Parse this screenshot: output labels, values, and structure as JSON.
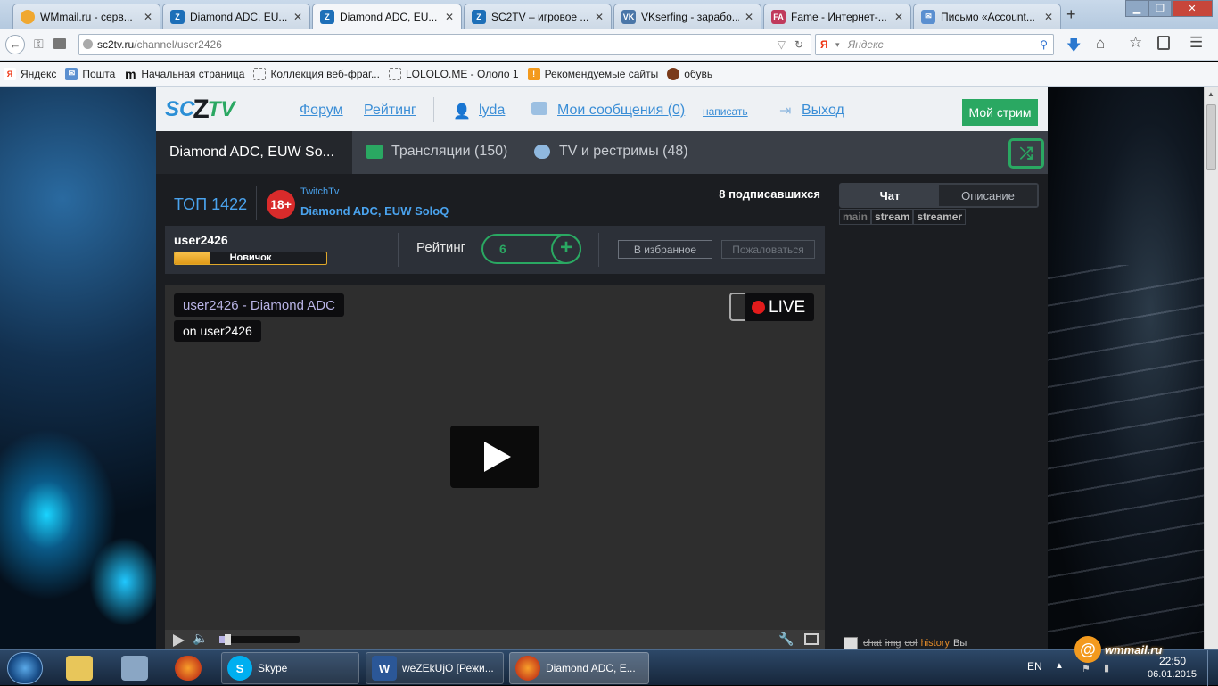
{
  "browser": {
    "tabs": [
      {
        "label": "WMmail.ru - серв...",
        "icon": "wmmail-favicon",
        "color": "#f0a830"
      },
      {
        "label": "Diamond ADC, EU...",
        "icon": "sc2tv-favicon",
        "color": "#1d6fb8"
      },
      {
        "label": "Diamond ADC, EU...",
        "icon": "sc2tv-favicon",
        "color": "#1d6fb8"
      },
      {
        "label": "SC2TV – игровое ...",
        "icon": "sc2tv-favicon",
        "color": "#1d6fb8"
      },
      {
        "label": "VKserfing - зарабо...",
        "icon": "vk-favicon",
        "color": "#4a76a8"
      },
      {
        "label": "Fame - Интернет-...",
        "icon": "fame-favicon",
        "color": "#c03a5c"
      },
      {
        "label": "Письмо «Account...",
        "icon": "mail-favicon",
        "color": "#5a8fd0"
      }
    ],
    "new_tab": "+",
    "url_host": "sc2tv.ru",
    "url_path": "/channel/user2426",
    "search_engine_badge": "Я",
    "search_placeholder": "Яндекс",
    "bookmarks": [
      {
        "label": "Яндекс",
        "icon": "yandex-icon"
      },
      {
        "label": "Пошта",
        "icon": "mail-icon"
      },
      {
        "label": "Начальная страница",
        "icon": "m-icon"
      },
      {
        "label": "Коллекция веб-фраг...",
        "icon": "webslice-icon"
      },
      {
        "label": "LOLOLO.ME - Ололо 1",
        "icon": "webslice-icon"
      },
      {
        "label": "Рекомендуемые сайты",
        "icon": "bulb-icon"
      },
      {
        "label": "обувь",
        "icon": "shoe-icon"
      }
    ]
  },
  "site": {
    "logo_sc": "SC",
    "logo_tv": "TV",
    "nav": {
      "forum": "Форум",
      "rating": "Рейтинг",
      "user": "lyda",
      "messages": "Мои сообщения (0)",
      "write": "написать",
      "logout": "Выход",
      "my_stream": "Мой стрим"
    },
    "subnav": {
      "active": "Diamond ADC, EUW So...",
      "broadcasts": "Трансляции (150)",
      "tv": "TV и рестримы (48)"
    },
    "channel": {
      "top": "ТОП 1422",
      "age": "18+",
      "source": "TwitchTv",
      "title": "Diamond ADC, EUW SoloQ",
      "subscribers": "8 подписавшихся",
      "username": "user2426",
      "rank": "Новичок",
      "rank_progress": 0.23,
      "rating_label": "Рейтинг",
      "rating_value": "6",
      "favorite": "В избранное",
      "report": "Пожаловаться"
    },
    "player": {
      "title": "user2426 - Diamond ADC",
      "on": "on user2426",
      "live": "LIVE",
      "volume": 0.1
    },
    "chat": {
      "tab_chat": "Чат",
      "tab_desc": "Описание",
      "channels": [
        "main",
        "stream",
        "streamer"
      ],
      "footer_links": [
        "chat",
        "img",
        "col"
      ],
      "history": "history",
      "footer_text": "Вы"
    }
  },
  "taskbar": {
    "windows": [
      {
        "label": "Skype",
        "icon": "skype-icon",
        "color": "#00aff0"
      },
      {
        "label": "weZEkUjO [Режи...",
        "icon": "word-icon",
        "color": "#2b5797"
      },
      {
        "label": "Diamond ADC, E...",
        "icon": "firefox-icon",
        "color": "#e66000"
      }
    ],
    "lang": "EN",
    "time": "22:50",
    "date": "06.01.2015",
    "wmmail_badge": "wmmail.ru"
  }
}
